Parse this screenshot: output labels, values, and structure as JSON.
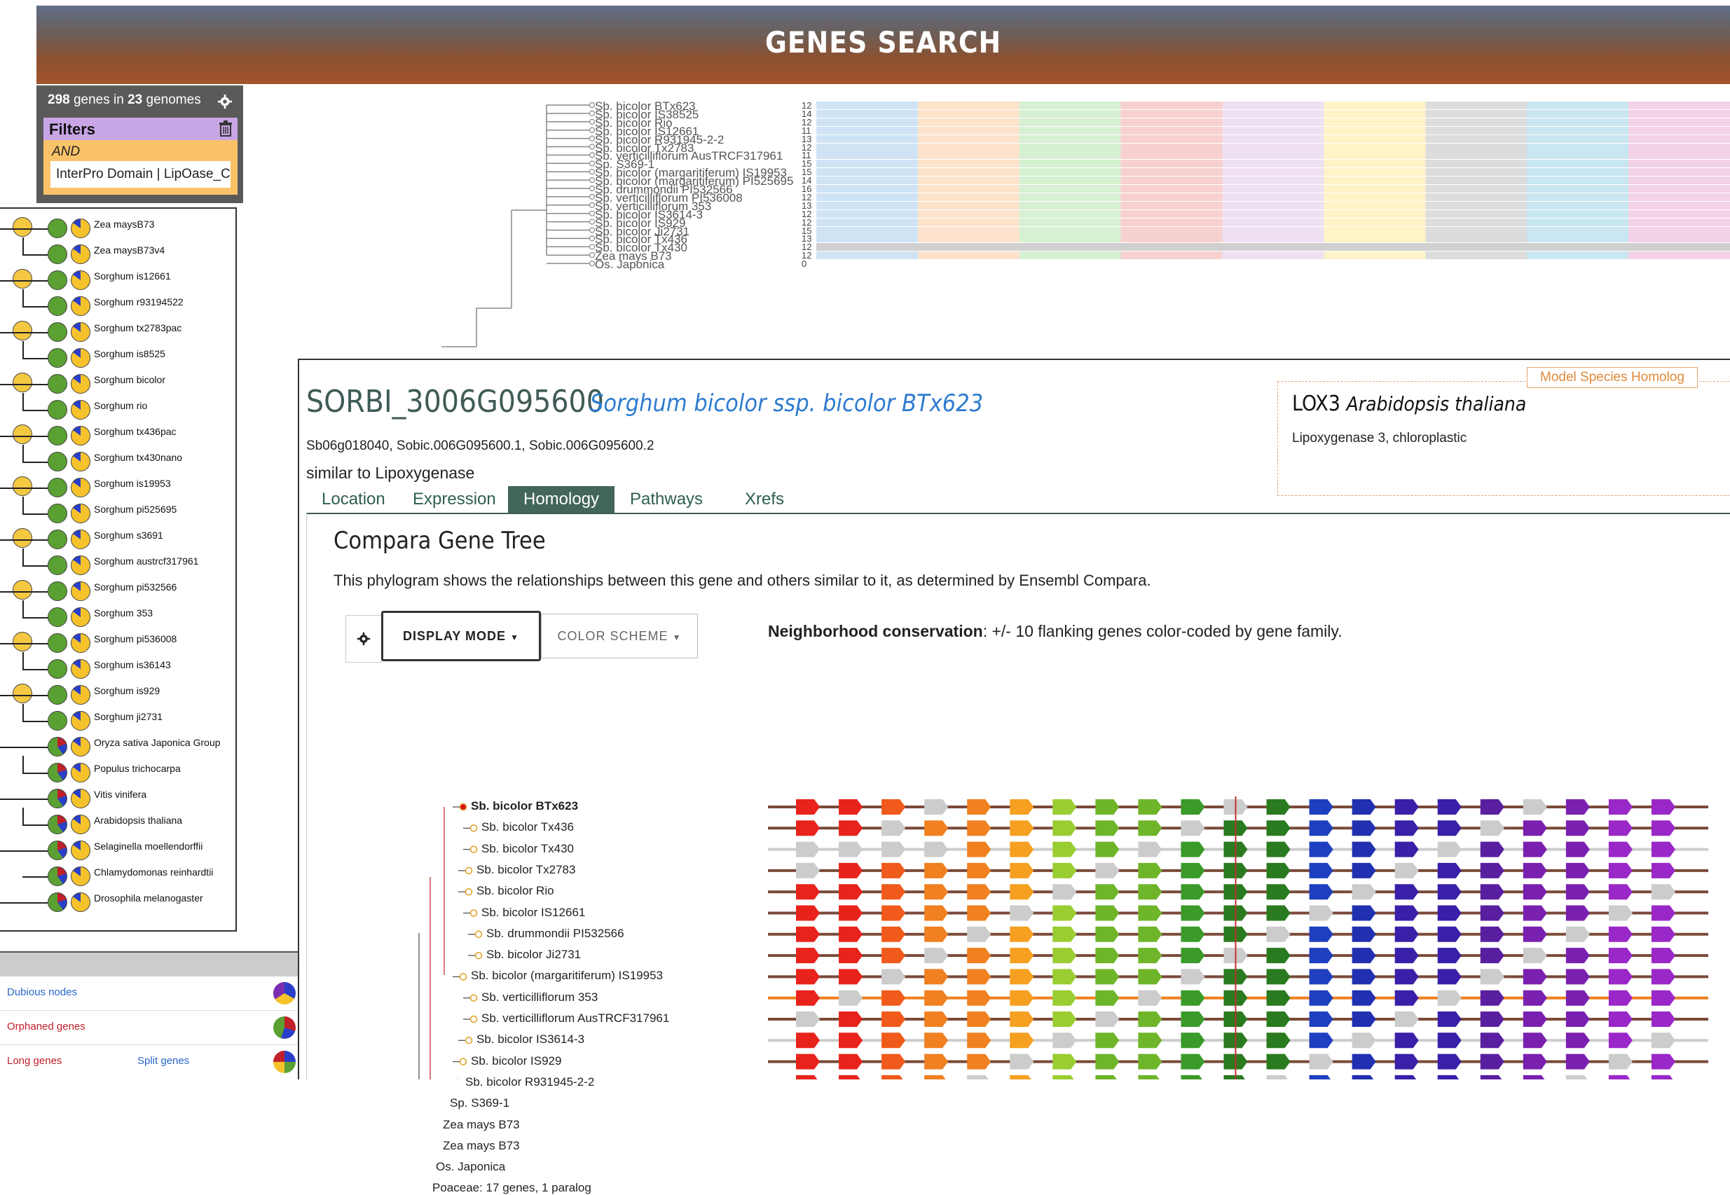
{
  "header": {
    "title": "GENES SEARCH"
  },
  "search_summary": {
    "gene_count": "298",
    "genes_in": "genes in",
    "genome_count": "23",
    "genomes_label": "genomes"
  },
  "filters": {
    "label": "Filters",
    "operator": "AND",
    "active_filter": "InterPro Domain | LipOase_C"
  },
  "species_tree": [
    {
      "label": "Zea maysB73"
    },
    {
      "label": "Zea maysB73v4"
    },
    {
      "label": "Sorghum is12661"
    },
    {
      "label": "Sorghum r93194522"
    },
    {
      "label": "Sorghum tx2783pac"
    },
    {
      "label": "Sorghum is8525"
    },
    {
      "label": "Sorghum bicolor"
    },
    {
      "label": "Sorghum rio"
    },
    {
      "label": "Sorghum tx436pac"
    },
    {
      "label": "Sorghum tx430nano"
    },
    {
      "label": "Sorghum is19953"
    },
    {
      "label": "Sorghum pi525695"
    },
    {
      "label": "Sorghum s3691"
    },
    {
      "label": "Sorghum austrcf317961"
    },
    {
      "label": "Sorghum pi532566"
    },
    {
      "label": "Sorghum 353"
    },
    {
      "label": "Sorghum pi536008"
    },
    {
      "label": "Sorghum is36143"
    },
    {
      "label": "Sorghum is929"
    },
    {
      "label": "Sorghum ji2731"
    },
    {
      "label": "Oryza sativa Japonica Group"
    },
    {
      "label": "Populus trichocarpa"
    },
    {
      "label": "Vitis vinifera"
    },
    {
      "label": "Arabidopsis thaliana"
    },
    {
      "label": "Selaginella moellendorffii"
    },
    {
      "label": "Chlamydomonas reinhardtii"
    },
    {
      "label": "Drosophila melanogaster"
    }
  ],
  "legend": {
    "dubious": "Dubious nodes",
    "orphaned": "Orphaned genes",
    "long": "Long genes",
    "split": "Split genes"
  },
  "alignment": {
    "rows": [
      {
        "label": "Sb. bicolor BTx623",
        "count": "12"
      },
      {
        "label": "Sb. bicolor IS38525",
        "count": "14"
      },
      {
        "label": "Sb. bicolor Rio",
        "count": "12"
      },
      {
        "label": "Sb. bicolor IS12661",
        "count": "11"
      },
      {
        "label": "Sb. bicolor R931945-2-2",
        "count": "13"
      },
      {
        "label": "Sb. bicolor Tx2783",
        "count": "12"
      },
      {
        "label": "Sb. verticilliflorum AusTRCF317961",
        "count": "11"
      },
      {
        "label": "Sp. S369-1",
        "count": "15"
      },
      {
        "label": "Sb. bicolor (margaritiferum) IS19953",
        "count": "15"
      },
      {
        "label": "Sb. bicolor (margaritiferum) PI525695",
        "count": "14"
      },
      {
        "label": "Sb. drummondii PI532566",
        "count": "16"
      },
      {
        "label": "Sb. verticilliflorum PI536008",
        "count": "12"
      },
      {
        "label": "Sb. verticilliflorum 353",
        "count": "13"
      },
      {
        "label": "Sb. bicolor IS3614-3",
        "count": "12"
      },
      {
        "label": "Sb. bicolor IS929",
        "count": "12"
      },
      {
        "label": "Sb. bicolor Ji2731",
        "count": "15"
      },
      {
        "label": "Sb. bicolor Tx436",
        "count": "13"
      },
      {
        "label": "Sb. bicolor Tx430",
        "count": "12"
      },
      {
        "label": "Zea mays B73",
        "count": "12"
      },
      {
        "label": "Os. Japonica",
        "count": "0"
      }
    ]
  },
  "gene": {
    "id": "SORBI_3006G095600",
    "species": "Sorghum bicolor ssp. bicolor BTx623",
    "synonyms": "Sb06g018040, Sobic.006G095600.1, Sobic.006G095600.2",
    "description": "similar to Lipoxygenase"
  },
  "homolog": {
    "tag": "Model Species Homolog",
    "name": "LOX3",
    "species": "Arabidopsis thaliana",
    "description": "Lipoxygenase 3, chloroplastic"
  },
  "tabs": [
    {
      "label": "Location",
      "active": false
    },
    {
      "label": "Expression",
      "active": false
    },
    {
      "label": "Homology",
      "active": true
    },
    {
      "label": "Pathways",
      "active": false
    },
    {
      "label": "Xrefs",
      "active": false
    }
  ],
  "compara": {
    "title": "Compara Gene Tree",
    "description": "This phylogram shows the relationships between this gene and others similar to it, as determined by Ensembl Compara.",
    "display_mode": "DISPLAY MODE",
    "color_scheme": "COLOR SCHEME",
    "neighborhood_label": "Neighborhood conservation",
    "neighborhood_text": ": +/- 10 flanking genes color-coded by gene family."
  },
  "gene_tree": [
    {
      "label": "Sb. bicolor BTx623",
      "bold": true
    },
    {
      "label": "Sb. bicolor Tx436"
    },
    {
      "label": "Sb. bicolor Tx430"
    },
    {
      "label": "Sb. bicolor Tx2783"
    },
    {
      "label": "Sb. bicolor Rio"
    },
    {
      "label": "Sb. bicolor IS12661"
    },
    {
      "label": "Sb. drummondii PI532566"
    },
    {
      "label": "Sb. bicolor Ji2731"
    },
    {
      "label": "Sb. bicolor (margaritiferum) IS19953"
    },
    {
      "label": "Sb. verticilliflorum 353"
    },
    {
      "label": "Sb. verticilliflorum AusTRCF317961"
    },
    {
      "label": "Sb. bicolor IS3614-3"
    },
    {
      "label": "Sb. bicolor IS929"
    },
    {
      "label": "Sb. bicolor R931945-2-2"
    },
    {
      "label": "Sp. S369-1"
    },
    {
      "label": "Zea mays B73"
    },
    {
      "label": "Zea mays B73"
    },
    {
      "label": "Os. Japonica"
    },
    {
      "label": "Poaceae: 17 genes, 1 paralog"
    }
  ],
  "colors": {
    "accent": "#43665c",
    "species_link": "#2e7bcf",
    "gene_families": [
      "#e8231c",
      "#f05a1a",
      "#f08020",
      "#f5a020",
      "#9acd32",
      "#6fb52a",
      "#3a9a2a",
      "#2a7a1f",
      "#1e3fbf",
      "#2030b0",
      "#3a1fa8",
      "#5a1fa0",
      "#7a20b0",
      "#9a28c8",
      "#cccccc"
    ]
  }
}
